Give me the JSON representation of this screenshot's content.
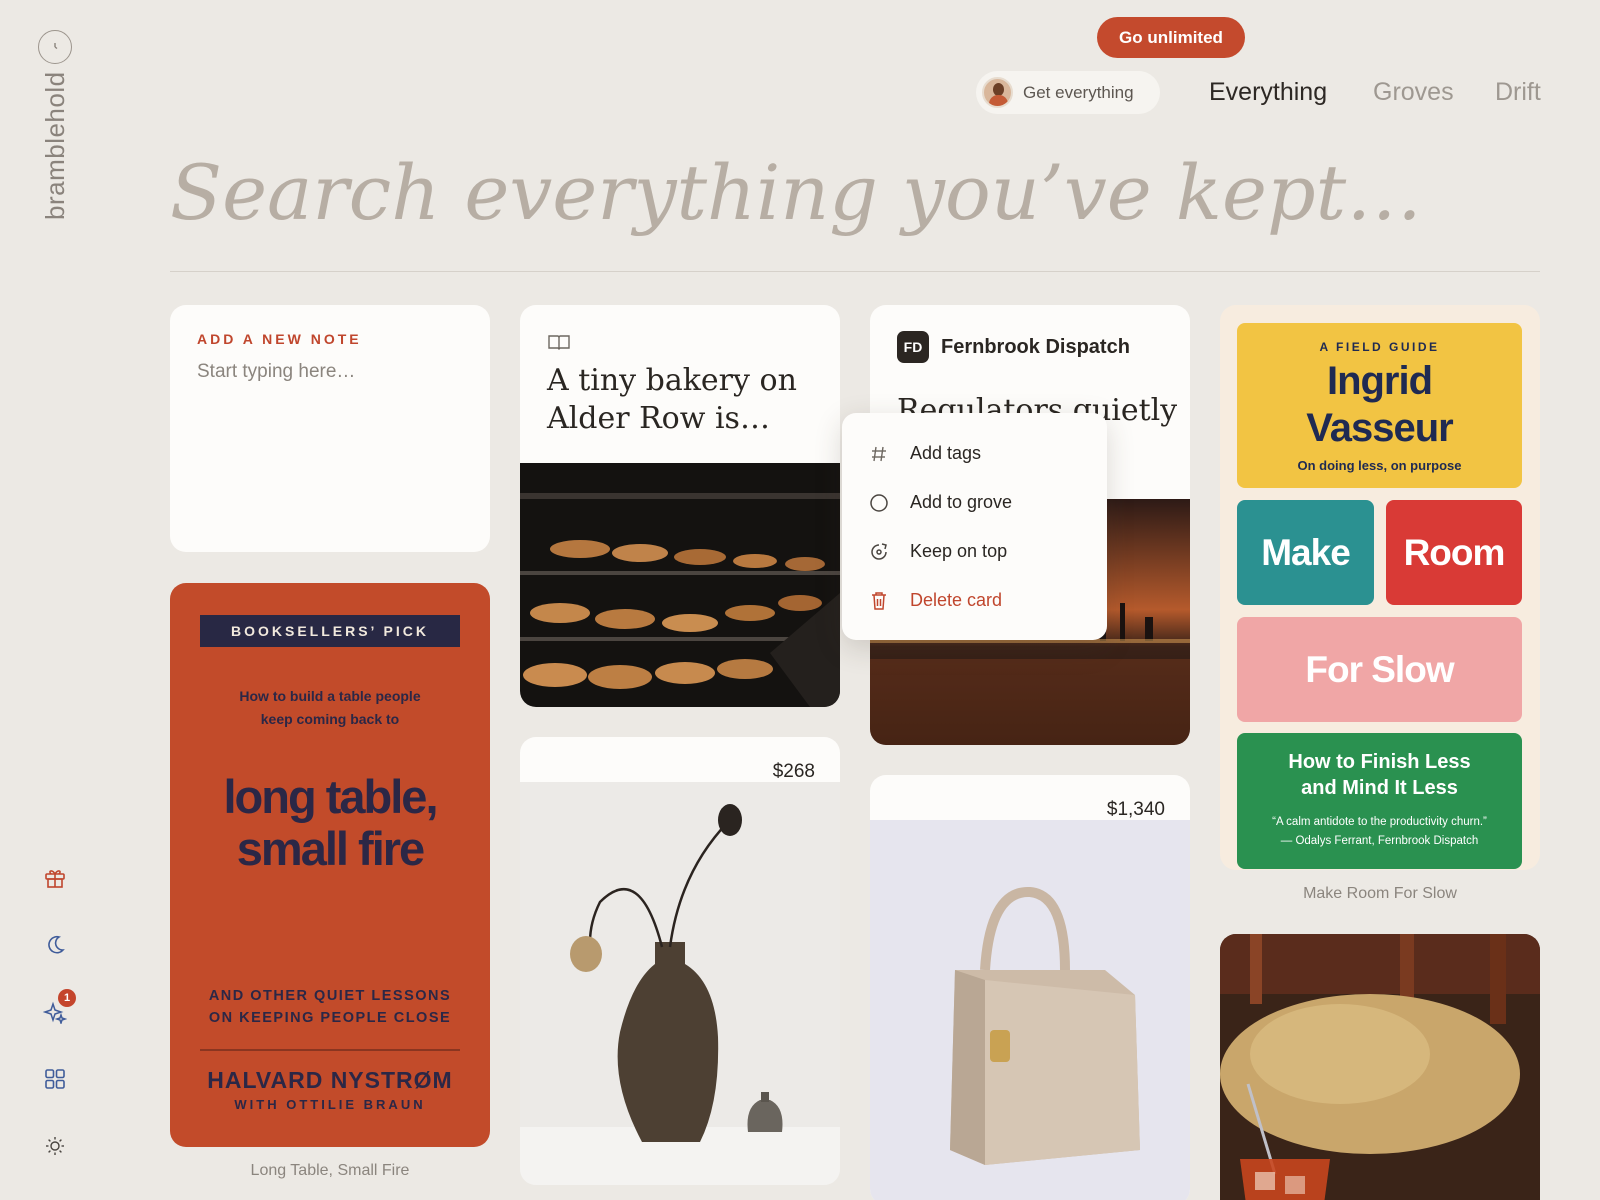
{
  "app": {
    "brand": "bramblehold"
  },
  "header": {
    "cta_label": "Go unlimited",
    "get_label": "Get everything",
    "tabs": [
      {
        "label": "Everything",
        "active": true
      },
      {
        "label": "Groves",
        "active": false
      },
      {
        "label": "Drift",
        "active": false
      }
    ]
  },
  "search": {
    "placeholder": "Search everything you’ve kept…"
  },
  "sidebar": {
    "icons": [
      "gift-icon",
      "moon-icon",
      "sparkle-icon",
      "grid-icon",
      "sun-icon"
    ],
    "sparkle_badge": "1"
  },
  "note_card": {
    "title": "ADD A NEW NOTE",
    "placeholder": "Start typing here…"
  },
  "book_card": {
    "banner": "BOOKSELLERS’ PICK",
    "subtitle_line1": "How to build a table people",
    "subtitle_line2": "keep coming back to",
    "title_line1": "long table,",
    "title_line2": "small fire",
    "lessons_line1": "AND OTHER QUIET LESSONS",
    "lessons_line2": "ON KEEPING PEOPLE CLOSE",
    "author": "HALVARD NYSTRØM",
    "coauthor": "WITH OTTILIE BRAUN",
    "caption": "Long Table, Small Fire"
  },
  "bakery_card": {
    "title_line1": "A tiny bakery on",
    "title_line2": "Alder Row is…"
  },
  "vase_card": {
    "price": "$268"
  },
  "news_card": {
    "publisher_logo": "FD",
    "publisher": "Fernbrook Dispatch",
    "headline": "Regulators quietly"
  },
  "bag_card": {
    "price": "$1,340"
  },
  "context_menu": {
    "items": [
      {
        "label": "Add tags",
        "icon": "hash-icon"
      },
      {
        "label": "Add to grove",
        "icon": "circle-icon"
      },
      {
        "label": "Keep on top",
        "icon": "pin-icon"
      },
      {
        "label": "Delete card",
        "icon": "trash-icon",
        "danger": true
      }
    ]
  },
  "room_card": {
    "kicker": "A FIELD GUIDE",
    "name_line1": "Ingrid",
    "name_line2": "Vasseur",
    "tagline": "On doing less, on purpose",
    "make": "Make",
    "room": "Room",
    "slow": "For Slow",
    "finish_line1": "How to Finish Less",
    "finish_line2": "and Mind It Less",
    "quote_line1": "“A calm antidote to the productivity churn.”",
    "quote_line2": "— Odalys Ferrant, Fernbrook Dispatch",
    "caption": "Make Room For Slow"
  },
  "colors": {
    "accent": "#c44a2d",
    "background": "#ece9e4"
  }
}
